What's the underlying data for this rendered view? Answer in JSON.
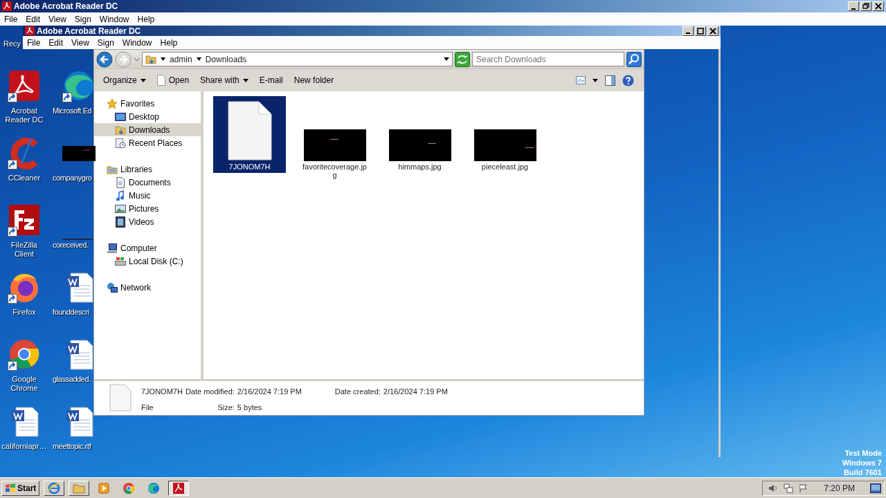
{
  "outer_window": {
    "title": "Adobe Acrobat Reader DC",
    "menu": [
      "File",
      "Edit",
      "View",
      "Sign",
      "Window",
      "Help"
    ]
  },
  "inner_window": {
    "title": "Adobe Acrobat Reader DC",
    "menu": [
      "File",
      "Edit",
      "View",
      "Sign",
      "Window",
      "Help"
    ]
  },
  "desktop_partial_label": "Recy",
  "desktop_columns": [
    [
      {
        "label": "Acrobat Reader DC",
        "kind": "acrobat",
        "shortcut": true
      },
      {
        "label": "CCleaner",
        "kind": "ccleaner",
        "shortcut": true
      },
      {
        "label": "FileZilla Client",
        "kind": "filezilla",
        "shortcut": true
      },
      {
        "label": "Firefox",
        "kind": "firefox",
        "shortcut": true
      },
      {
        "label": "Google Chrome",
        "kind": "chrome",
        "shortcut": true
      },
      {
        "label": "californiapr…",
        "kind": "word",
        "shortcut": false
      }
    ],
    [
      {
        "label": "Microsoft Ed",
        "kind": "edge",
        "shortcut": true
      },
      {
        "label": "companygro",
        "kind": "image",
        "shortcut": false
      },
      {
        "label": "coreceived.",
        "kind": "blank",
        "shortcut": false
      },
      {
        "label": "founddescri",
        "kind": "word",
        "shortcut": false
      },
      {
        "label": "glassadded.",
        "kind": "word",
        "shortcut": false
      },
      {
        "label": "meettopic.rtf",
        "kind": "word",
        "shortcut": false
      }
    ]
  ],
  "explorer": {
    "path": [
      "admin",
      "Downloads"
    ],
    "search_placeholder": "Search Downloads",
    "toolbar": [
      {
        "label": "Organize",
        "kind": "menu"
      },
      {
        "label": "Open",
        "kind": "file"
      },
      {
        "label": "Share with",
        "kind": "menu"
      },
      {
        "label": "E-mail",
        "kind": "plain"
      },
      {
        "label": "New folder",
        "kind": "plain"
      }
    ],
    "nav_tree": [
      {
        "label": "Favorites",
        "selected": false,
        "children": [
          {
            "label": "Desktop",
            "selected": false
          },
          {
            "label": "Downloads",
            "selected": true
          },
          {
            "label": "Recent Places",
            "selected": false
          }
        ]
      },
      {
        "label": "Libraries",
        "selected": false,
        "children": [
          {
            "label": "Documents",
            "selected": false
          },
          {
            "label": "Music",
            "selected": false
          },
          {
            "label": "Pictures",
            "selected": false
          },
          {
            "label": "Videos",
            "selected": false
          }
        ]
      },
      {
        "label": "Computer",
        "selected": false,
        "children": [
          {
            "label": "Local Disk (C:)",
            "selected": false
          }
        ]
      },
      {
        "label": "Network",
        "selected": false
      }
    ],
    "files": [
      {
        "name": "7JONOM7H",
        "kind": "document",
        "selected": true
      },
      {
        "name": "favoritecoverage.jpg",
        "kind": "image",
        "selected": false
      },
      {
        "name": "himmaps.jpg",
        "kind": "image",
        "selected": false
      },
      {
        "name": "pieceleast.jpg",
        "kind": "image",
        "selected": false
      }
    ],
    "details": {
      "name": "7JONOM7H",
      "type": "File",
      "modified_label": "Date modified:",
      "modified": "2/16/2024 7:19 PM",
      "created_label": "Date created:",
      "created": "2/16/2024 7:19 PM",
      "size_label": "Size:",
      "size": "5 bytes"
    }
  },
  "system_notice": [
    "Test Mode",
    "Windows 7",
    "Build 7601"
  ],
  "taskbar": {
    "start": "Start",
    "apps": [
      {
        "kind": "ie",
        "active": false
      },
      {
        "kind": "folder",
        "active": false
      },
      {
        "kind": "media",
        "active": false
      },
      {
        "kind": "chrome",
        "active": false
      },
      {
        "kind": "edge",
        "active": false
      },
      {
        "kind": "acrobat",
        "active": true
      }
    ],
    "clock": "7:20 PM"
  }
}
